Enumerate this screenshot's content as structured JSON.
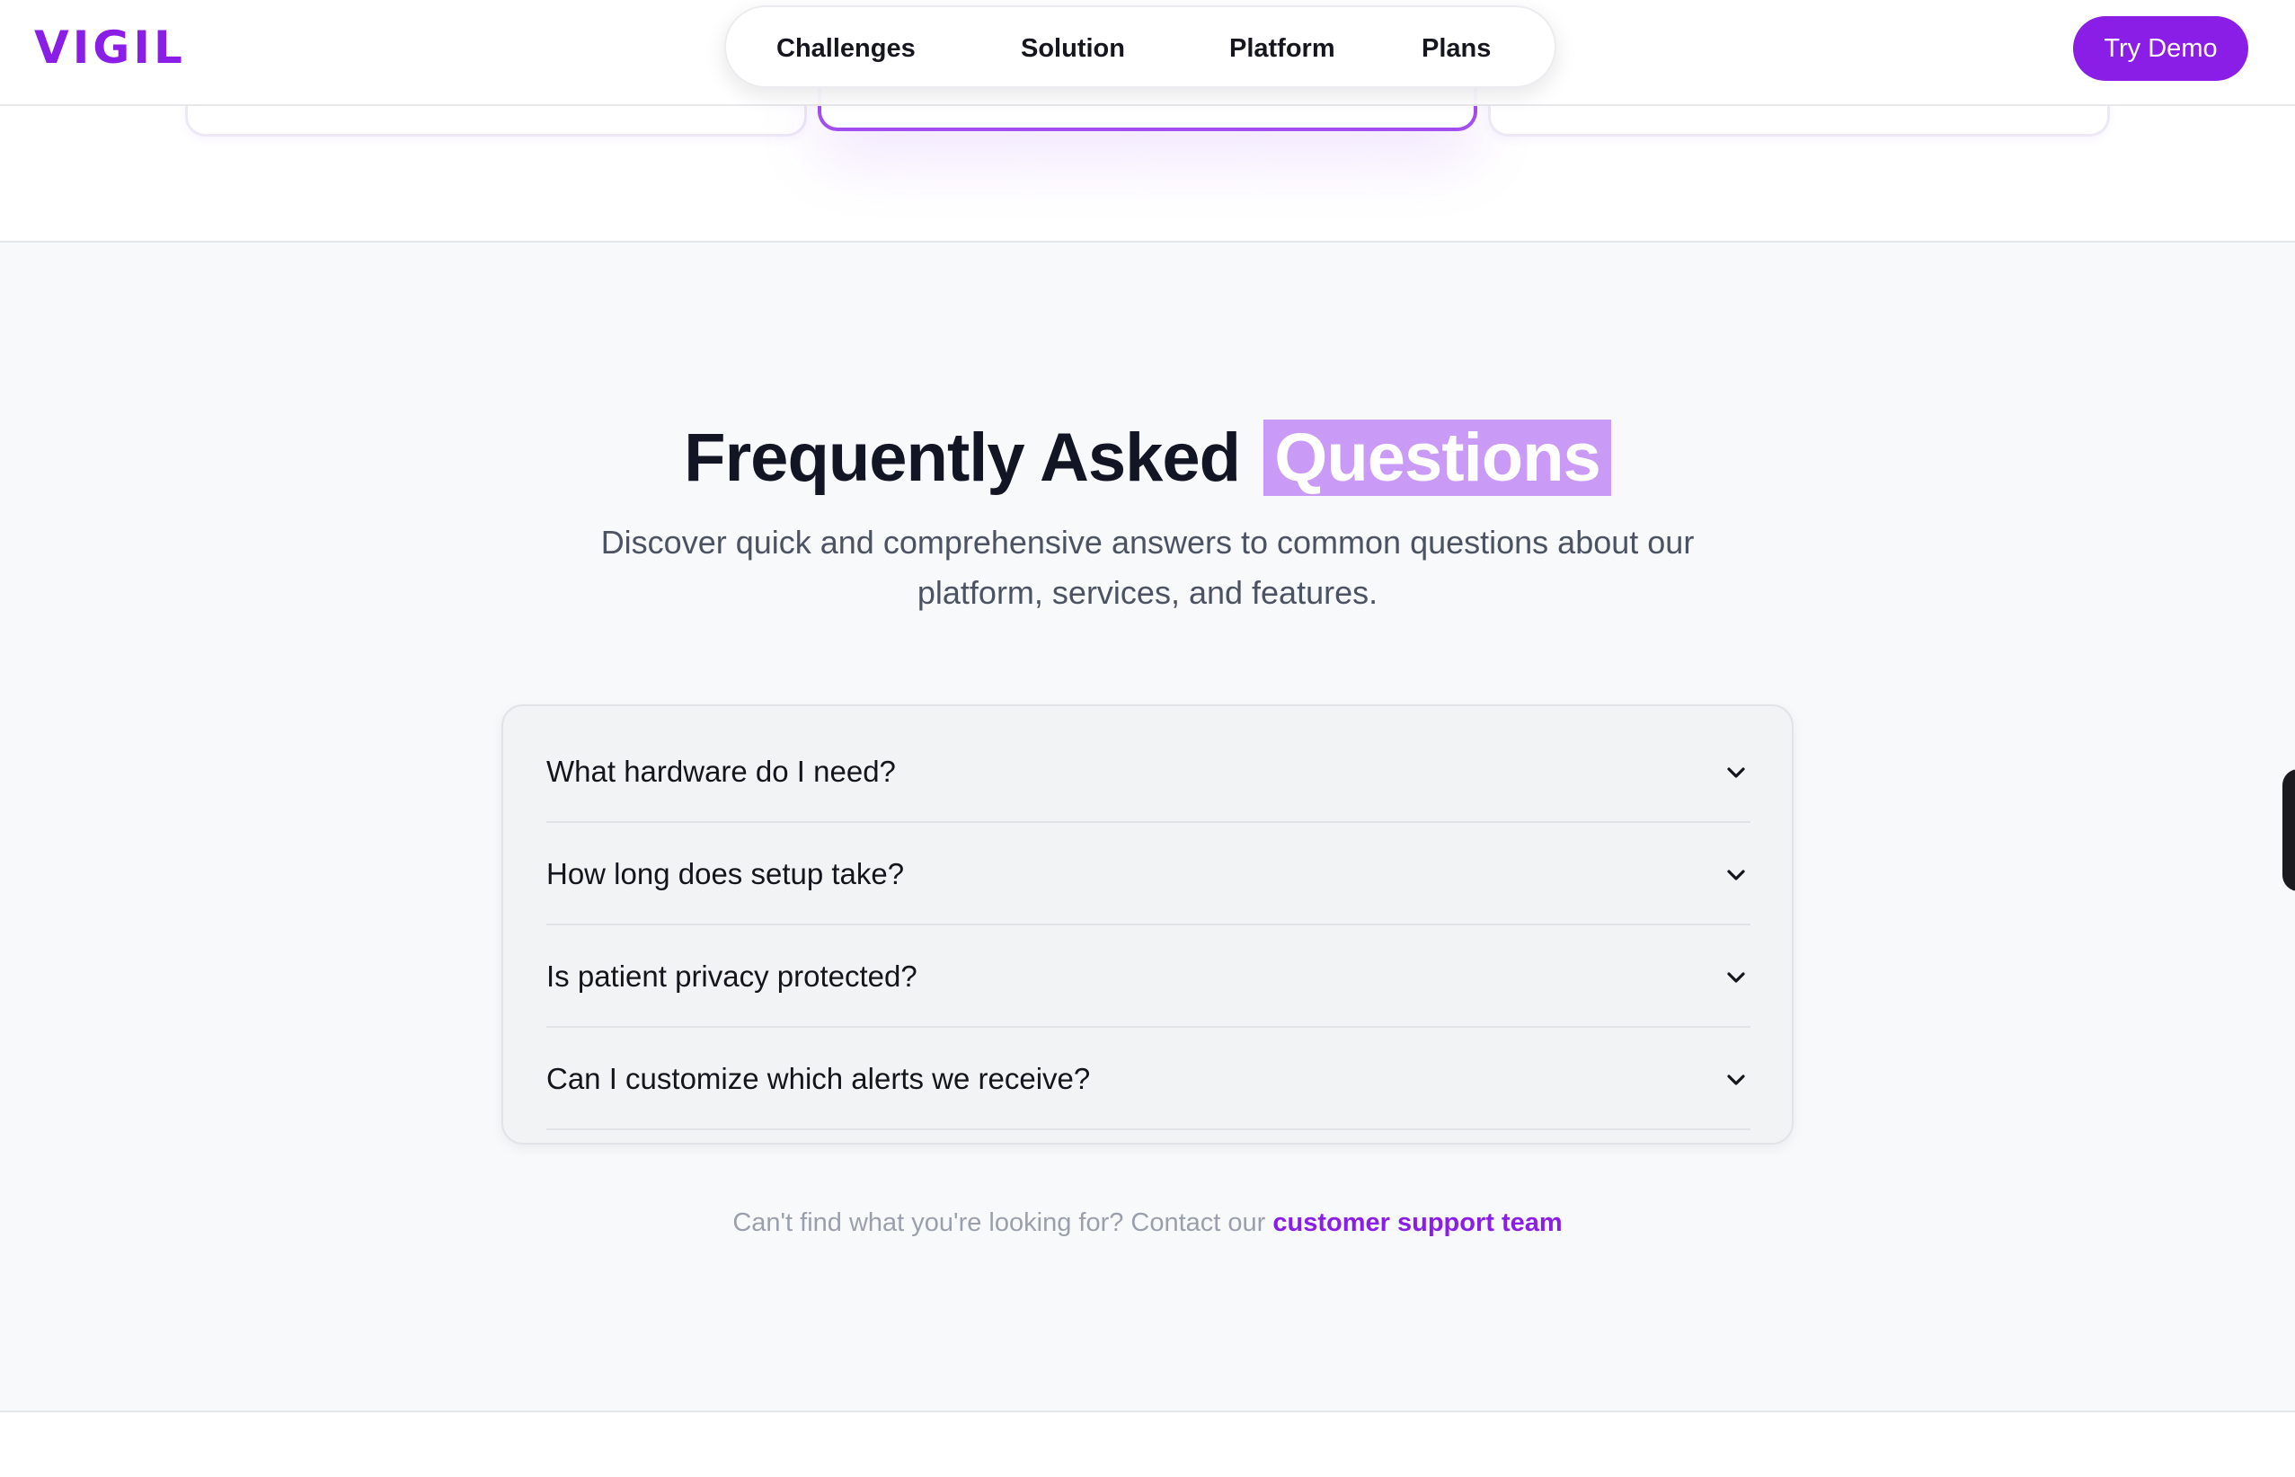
{
  "header": {
    "logo": "VIGIL",
    "nav": [
      {
        "label": "Challenges"
      },
      {
        "label": "Solution"
      },
      {
        "label": "Platform"
      },
      {
        "label": "Plans"
      }
    ],
    "cta_label": "Try Demo"
  },
  "faq": {
    "title_main": "Frequently Asked",
    "title_highlight": "Questions",
    "subtitle_line1": "Discover quick and comprehensive answers to common questions about our",
    "subtitle_line2": "platform, services, and features.",
    "items": [
      {
        "question": "What hardware do I need?"
      },
      {
        "question": "How long does setup take?"
      },
      {
        "question": "Is patient privacy protected?"
      },
      {
        "question": "Can I customize which alerts we receive?"
      }
    ],
    "footer_text": "Can't find what you're looking for? Contact our",
    "footer_link": "customer support team"
  },
  "colors": {
    "accent": "#8a1ee6",
    "highlight_bg": "#c99af6",
    "section_bg": "#f8f9fb"
  },
  "icons": {
    "faq_toggle": "chevron-down-icon"
  }
}
